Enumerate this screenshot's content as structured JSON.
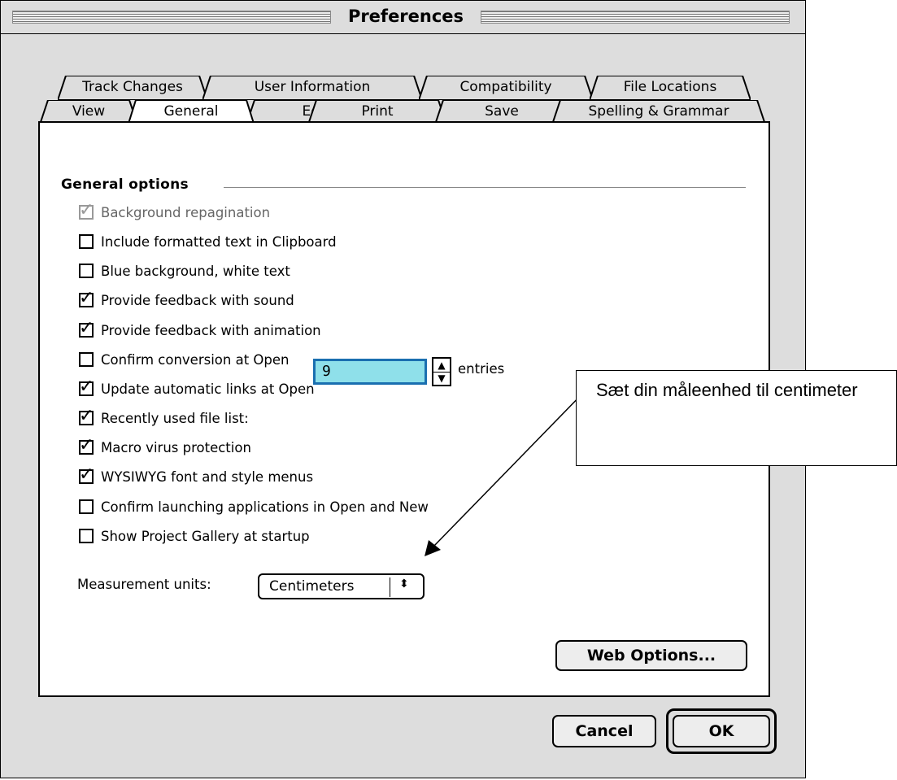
{
  "window": {
    "title": "Preferences"
  },
  "tabs": {
    "back_row": [
      "Track Changes",
      "User Information",
      "Compatibility",
      "File Locations"
    ],
    "front_row": [
      "View",
      "General",
      "Edit",
      "Print",
      "Save",
      "Spelling & Grammar"
    ],
    "active": "General"
  },
  "general": {
    "group_title": "General options",
    "options": [
      {
        "label": "Background repagination",
        "checked": true,
        "disabled": true
      },
      {
        "label": "Include formatted text in Clipboard",
        "checked": false
      },
      {
        "label": "Blue background, white text",
        "checked": false
      },
      {
        "label": "Provide feedback with sound",
        "checked": true
      },
      {
        "label": "Provide feedback with animation",
        "checked": true
      },
      {
        "label": "Confirm conversion at Open",
        "checked": false
      },
      {
        "label": "Update automatic links at Open",
        "checked": true
      },
      {
        "label": "Recently used file list:",
        "checked": true
      },
      {
        "label": "Macro virus protection",
        "checked": true
      },
      {
        "label": "WYSIWYG font and style menus",
        "checked": true
      },
      {
        "label": "Confirm launching applications in Open and New",
        "checked": false
      },
      {
        "label": "Show Project Gallery at startup",
        "checked": false
      }
    ],
    "recent_files_count": "9",
    "entries_label": "entries",
    "measurement_label": "Measurement units:",
    "measurement_value": "Centimeters",
    "web_options_label": "Web Options..."
  },
  "buttons": {
    "cancel": "Cancel",
    "ok": "OK"
  },
  "callout": {
    "text": "Sæt din måleenhed til centimeter"
  },
  "colors": {
    "field_fill": "#8fe0ea",
    "field_focus": "#1a6fb0",
    "window_bg": "#dddddd"
  },
  "icons": {
    "checkbox_check": "check-mark-icon",
    "stepper": "up-down-arrow-icon",
    "select": "updown-chevron-icon"
  }
}
